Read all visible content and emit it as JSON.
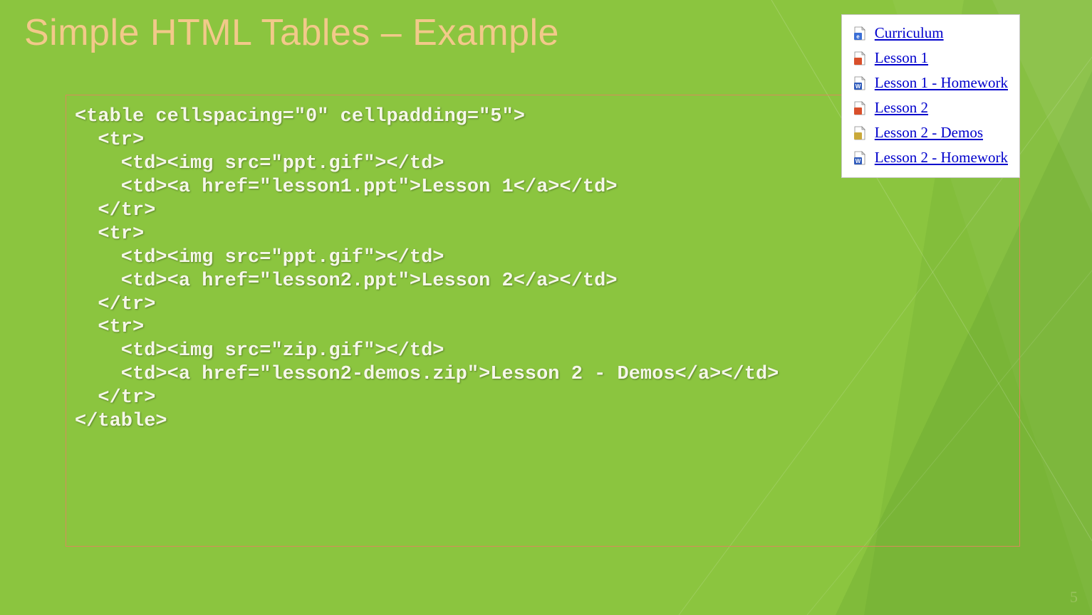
{
  "title": "Simple HTML Tables – Example",
  "code": "<table cellspacing=\"0\" cellpadding=\"5\">\n  <tr>\n    <td><img src=\"ppt.gif\"></td>\n    <td><a href=\"lesson1.ppt\">Lesson 1</a></td>\n  </tr>\n  <tr>\n    <td><img src=\"ppt.gif\"></td>\n    <td><a href=\"lesson2.ppt\">Lesson 2</a></td>\n  </tr>\n  <tr>\n    <td><img src=\"zip.gif\"></td>\n    <td><a href=\"lesson2-demos.zip\">Lesson 2 - Demos</a></td>\n  </tr>\n</table>",
  "rendered": {
    "rows": [
      {
        "icon": "ie",
        "label": "Curriculum"
      },
      {
        "icon": "ppt",
        "label": "Lesson 1"
      },
      {
        "icon": "word",
        "label": "Lesson 1 - Homework"
      },
      {
        "icon": "ppt",
        "label": "Lesson 2"
      },
      {
        "icon": "zip",
        "label": "Lesson 2 - Demos"
      },
      {
        "icon": "word",
        "label": "Lesson 2 - Homework"
      }
    ]
  },
  "page_number": "5"
}
